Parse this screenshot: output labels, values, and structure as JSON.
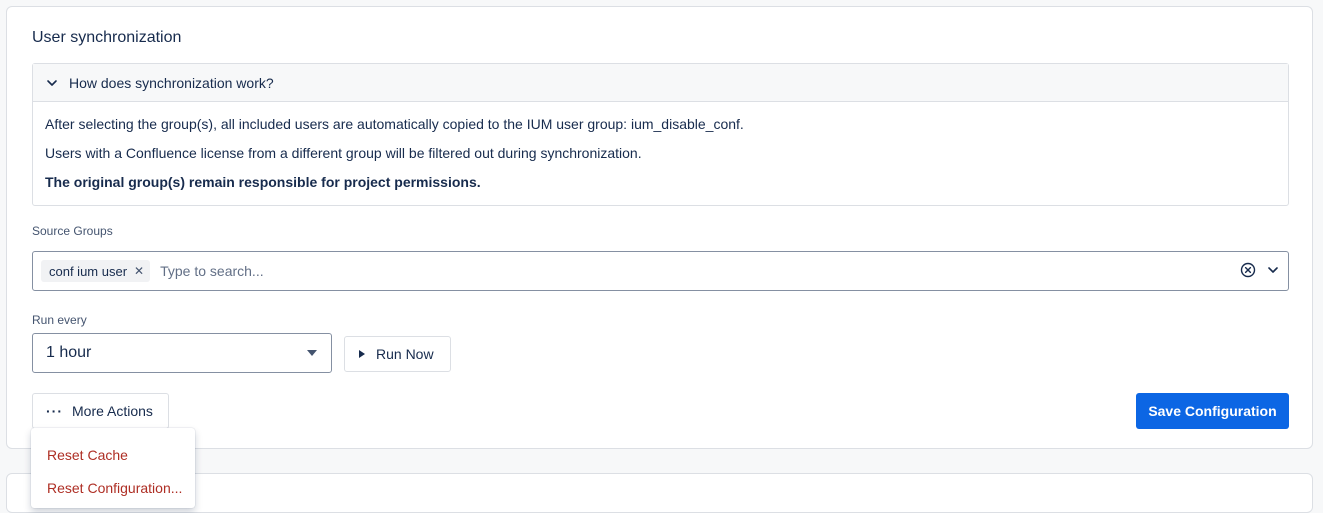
{
  "section": {
    "title": "User synchronization"
  },
  "info": {
    "header": "How does synchronization work?",
    "line1": "After selecting the group(s), all included users are automatically copied to the IUM user group: ium_disable_conf.",
    "line2": "Users with a Confluence license from a different group will be filtered out during synchronization.",
    "line3": "The original group(s) remain responsible for project permissions."
  },
  "source_groups": {
    "label": "Source Groups",
    "tags": [
      "conf ium user"
    ],
    "placeholder": "Type to search..."
  },
  "run_every": {
    "label": "Run every",
    "value": "1 hour"
  },
  "buttons": {
    "run_now": "Run Now",
    "more_actions": "More Actions",
    "save": "Save Configuration"
  },
  "menu": {
    "items": [
      "Reset Cache",
      "Reset Configuration..."
    ]
  },
  "colors": {
    "primary": "#0c66e4",
    "danger_text": "#ae2e24"
  }
}
